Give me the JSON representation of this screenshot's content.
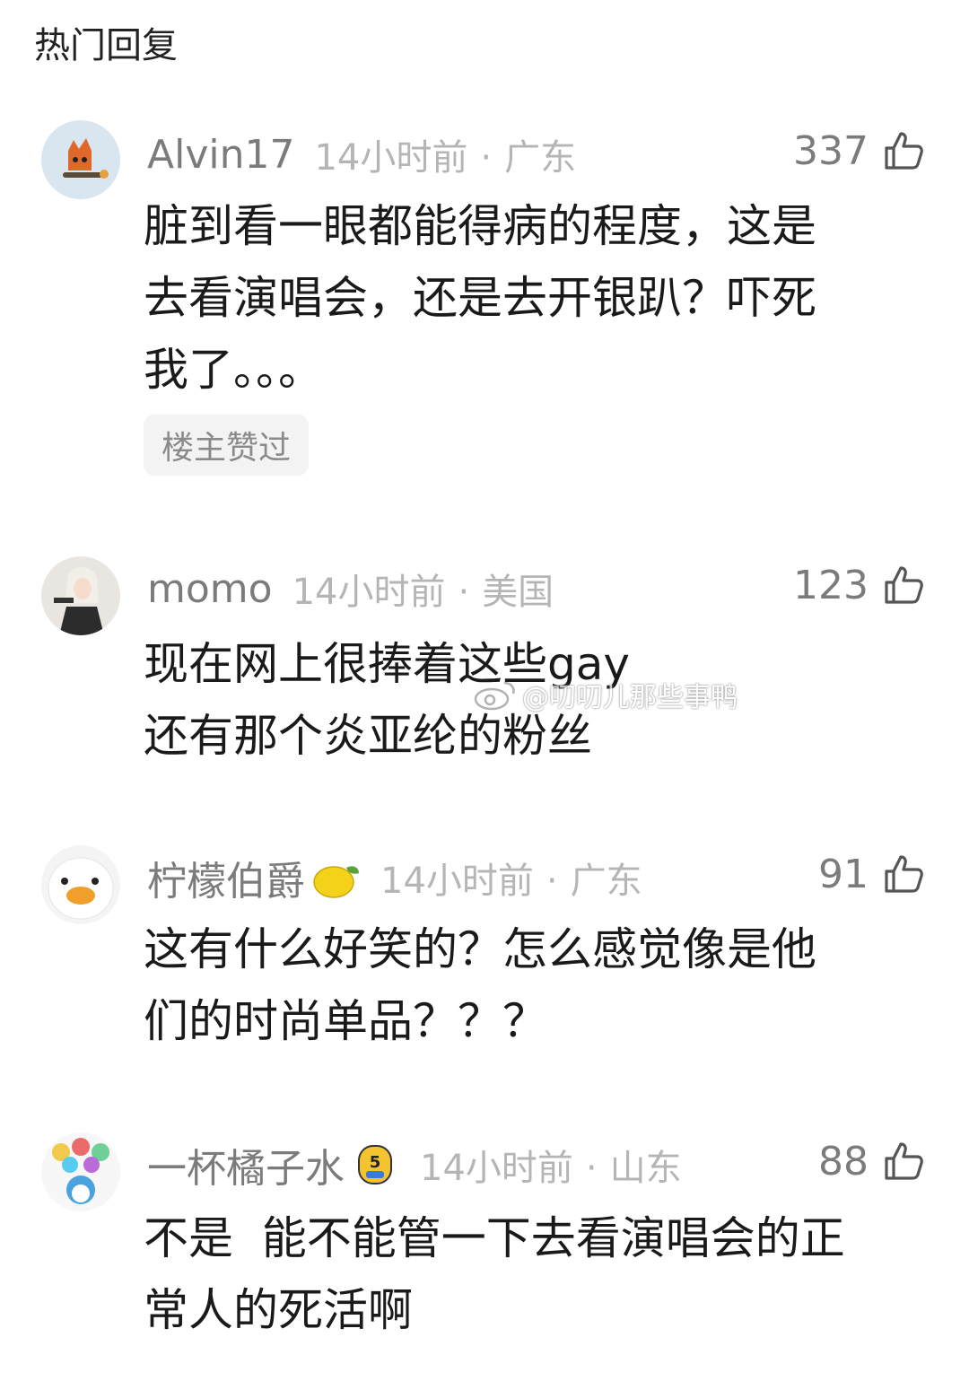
{
  "header": {
    "title": "热门回复"
  },
  "comments": [
    {
      "username": "Alvin17",
      "time": "14小时前",
      "location": "广东",
      "likes": "337",
      "lines": [
        "脏到看一眼都能得病的程度，这是",
        "去看演唱会，还是去开银趴？吓死",
        "我了。。。"
      ],
      "tag": "楼主赞过"
    },
    {
      "username": "momo",
      "time": "14小时前",
      "location": "美国",
      "likes": "123",
      "lines": [
        "现在网上很捧着这些gay",
        "还有那个炎亚纶的粉丝"
      ]
    },
    {
      "username": "柠檬伯爵",
      "time": "14小时前",
      "location": "广东",
      "likes": "91",
      "badge_icon": "lemon-icon",
      "lines": [
        "这有什么好笑的？怎么感觉像是他",
        "们的时尚单品？？？"
      ]
    },
    {
      "username": "一杯橘子水",
      "time": "14小时前",
      "location": "山东",
      "likes": "88",
      "badge_icon": "level-5-badge-icon",
      "badge_text": "5",
      "lines": [
        "不是  能不能管一下去看演唱会的正",
        "常人的死活啊"
      ]
    }
  ],
  "separator": "·",
  "watermark": {
    "text": "@叨叨儿那些事鸭",
    "icon": "weibo-icon"
  }
}
